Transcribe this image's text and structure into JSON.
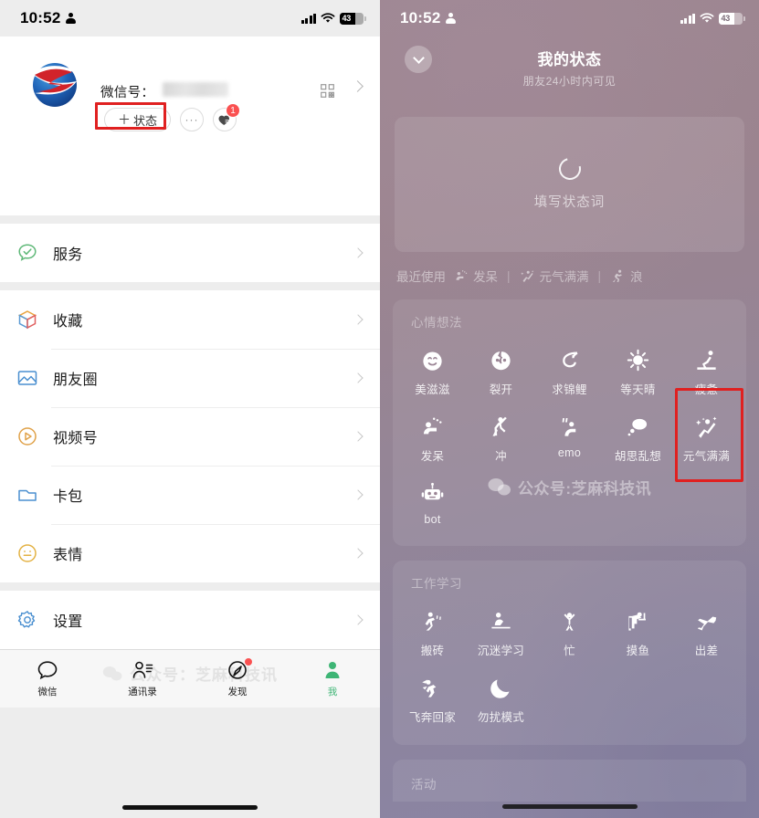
{
  "left": {
    "statusbar": {
      "time": "10:52",
      "battery": "43"
    },
    "profile": {
      "wechat_id_label": "微信号：",
      "wechat_id_value": "",
      "status_button": "状态",
      "status_plus": "＋",
      "more_button": "···",
      "like_badge": "1"
    },
    "menu_groups": [
      {
        "items": [
          {
            "label": "服务",
            "icon": "service-icon"
          }
        ]
      },
      {
        "items": [
          {
            "label": "收藏",
            "icon": "favorites-icon"
          },
          {
            "label": "朋友圈",
            "icon": "moments-icon"
          },
          {
            "label": "视频号",
            "icon": "channels-icon"
          },
          {
            "label": "卡包",
            "icon": "cards-icon"
          },
          {
            "label": "表情",
            "icon": "stickers-icon"
          }
        ]
      },
      {
        "items": [
          {
            "label": "设置",
            "icon": "settings-icon"
          }
        ]
      }
    ],
    "watermark": "公众号：芝麻科技讯",
    "tabs": [
      {
        "label": "微信",
        "icon": "chat-icon",
        "active": false,
        "dot": false
      },
      {
        "label": "通讯录",
        "icon": "contacts-icon",
        "active": false,
        "dot": false
      },
      {
        "label": "发现",
        "icon": "discover-icon",
        "active": false,
        "dot": true
      },
      {
        "label": "我",
        "icon": "me-icon",
        "active": true,
        "dot": false
      }
    ]
  },
  "right": {
    "statusbar": {
      "time": "10:52",
      "battery": "43"
    },
    "header": {
      "title": "我的状态",
      "subtitle": "朋友24小时内可见",
      "back_icon": "chevron-down-icon"
    },
    "status_card": {
      "hint": "填写状态词",
      "icon": "loading-ring-icon"
    },
    "recent": {
      "label": "最近使用",
      "items": [
        {
          "label": "发呆",
          "icon": "daze-icon"
        },
        {
          "label": "元气满满",
          "icon": "energetic-icon"
        },
        {
          "label": "浪",
          "icon": "wander-icon"
        }
      ]
    },
    "sections": [
      {
        "title": "心情想法",
        "items": [
          {
            "label": "美滋滋",
            "icon": "smile-icon",
            "highlighted": false
          },
          {
            "label": "裂开",
            "icon": "cracked-icon",
            "highlighted": false
          },
          {
            "label": "求锦鲤",
            "icon": "koi-icon",
            "highlighted": false
          },
          {
            "label": "等天晴",
            "icon": "sun-icon",
            "highlighted": false
          },
          {
            "label": "疲惫",
            "icon": "tired-icon",
            "highlighted": false
          },
          {
            "label": "发呆",
            "icon": "daze-icon",
            "highlighted": false
          },
          {
            "label": "冲",
            "icon": "charge-icon",
            "highlighted": false
          },
          {
            "label": "emo",
            "icon": "emo-icon",
            "highlighted": false
          },
          {
            "label": "胡思乱想",
            "icon": "thought-bubble-icon",
            "highlighted": false
          },
          {
            "label": "元气满满",
            "icon": "energetic-icon",
            "highlighted": true
          },
          {
            "label": "bot",
            "icon": "robot-icon",
            "highlighted": false
          }
        ]
      },
      {
        "title": "工作学习",
        "items": [
          {
            "label": "搬砖",
            "icon": "bricklaying-icon",
            "highlighted": false
          },
          {
            "label": "沉迷学习",
            "icon": "studying-icon",
            "highlighted": false
          },
          {
            "label": "忙",
            "icon": "busy-icon",
            "highlighted": false
          },
          {
            "label": "摸鱼",
            "icon": "slacking-icon",
            "highlighted": false
          },
          {
            "label": "出差",
            "icon": "airplane-icon",
            "highlighted": false
          },
          {
            "label": "飞奔回家",
            "icon": "running-home-icon",
            "highlighted": false
          },
          {
            "label": "勿扰模式",
            "icon": "moon-icon",
            "highlighted": false
          }
        ]
      }
    ],
    "bottom_section": {
      "title": "活动"
    },
    "watermark": "公众号:芝麻科技讯"
  },
  "colors": {
    "accent_green": "#3eb575",
    "badge_red": "#fa5151",
    "highlight_red": "#e02020"
  }
}
